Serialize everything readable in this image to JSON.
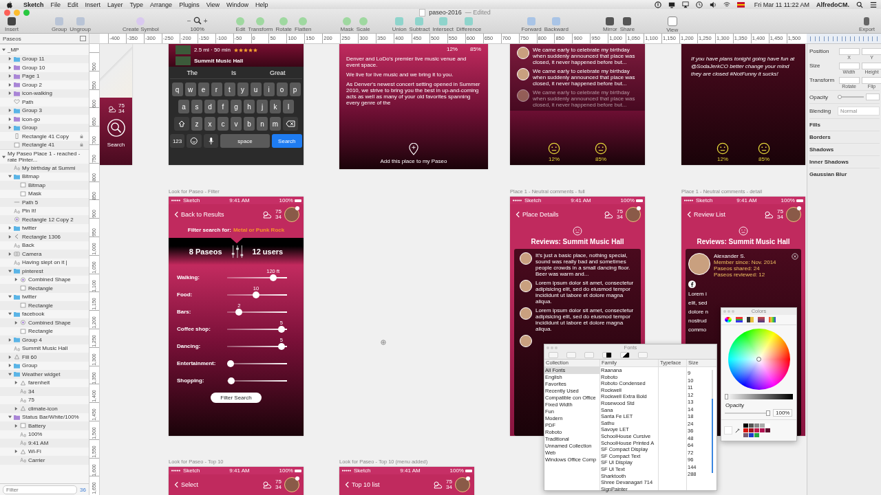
{
  "menubar": {
    "app": "Sketch",
    "menus": [
      "File",
      "Edit",
      "Insert",
      "Layer",
      "Type",
      "Arrange",
      "Plugins",
      "View",
      "Window",
      "Help"
    ],
    "clock": "Fri Mar 11  11:22 AM",
    "user": "AlfredoCM."
  },
  "window": {
    "title": "paseo-2016",
    "status": "— Edited"
  },
  "toolbar": {
    "groups": [
      {
        "kind": "tools",
        "items": [
          "Insert"
        ]
      },
      {
        "kind": "tools",
        "items": [
          "Group",
          "Ungroup"
        ]
      },
      {
        "kind": "tools",
        "items": [
          "Create Symbol"
        ]
      },
      {
        "kind": "zoom",
        "minus": "−",
        "plus": "+",
        "value": "100%"
      },
      {
        "kind": "tools",
        "items": [
          "Edit",
          "Transform",
          "Rotate",
          "Flatten"
        ]
      },
      {
        "kind": "tools",
        "items": [
          "Mask",
          "Scale"
        ]
      },
      {
        "kind": "tools",
        "items": [
          "Union",
          "Subtract",
          "Intersect",
          "Difference"
        ]
      },
      {
        "kind": "tools",
        "items": [
          "Forward",
          "Backward"
        ]
      },
      {
        "kind": "tools",
        "items": [
          "Mirror",
          "Share"
        ]
      },
      {
        "kind": "tools",
        "items": [
          "View"
        ]
      },
      {
        "kind": "tools",
        "items": [
          "Export"
        ]
      }
    ]
  },
  "rulers": {
    "horizontal": [
      "-400",
      "-350",
      "-300",
      "-250",
      "-200",
      "-150",
      "-100",
      "-50",
      "0",
      "50",
      "100",
      "150",
      "200",
      "250",
      "300",
      "350",
      "400",
      "450",
      "500",
      "550",
      "600",
      "650",
      "700",
      "750",
      "800",
      "850",
      "900",
      "950",
      "1,000",
      "1,050",
      "1,100",
      "1,150",
      "1,200",
      "1,250",
      "1,300",
      "1,350",
      "1,400",
      "1,450",
      "1,500"
    ],
    "vertical": [
      "500",
      "550",
      "600",
      "650",
      "700",
      "750",
      "800",
      "850",
      "900",
      "950",
      "1,000",
      "1,050",
      "1,100",
      "1,150",
      "1,200",
      "1,250",
      "1,300",
      "1,350",
      "1,400",
      "1,450",
      "1,500",
      "1,550",
      "1,600",
      "1,650"
    ]
  },
  "sidebar": {
    "page": "Paseos",
    "filter": {
      "placeholder": "Filter"
    },
    "count": "36",
    "layers": [
      {
        "name": "_MP",
        "kind": "artboard",
        "expanded": true,
        "children": [
          {
            "name": "Group 11",
            "kind": "group",
            "expanded": false,
            "locked": false
          },
          {
            "name": "Group 10",
            "kind": "symbol",
            "expanded": false,
            "locked": false
          },
          {
            "name": "Page 1",
            "kind": "symbol",
            "expanded": false,
            "locked": false
          },
          {
            "name": "Group 2",
            "kind": "symbol",
            "expanded": false,
            "locked": false
          },
          {
            "name": "icon-walking",
            "kind": "symbol",
            "expanded": false,
            "locked": false
          },
          {
            "name": "Path",
            "kind": "heart",
            "locked": false
          },
          {
            "name": "Group 3",
            "kind": "group",
            "expanded": false,
            "locked": false
          },
          {
            "name": "icon-go",
            "kind": "symbol",
            "expanded": false,
            "locked": false
          },
          {
            "name": "Group",
            "kind": "group",
            "expanded": false,
            "locked": false
          },
          {
            "name": "Rectangle 41 Copy",
            "kind": "phone",
            "locked": true
          },
          {
            "name": "Rectangle 41",
            "kind": "rect",
            "locked": true
          }
        ]
      },
      {
        "name": "My Paseo Place 1 - reached - rate Pinter...",
        "kind": "artboard",
        "expanded": true,
        "children": [
          {
            "name": "My birthday at Summi",
            "kind": "text"
          },
          {
            "name": "Bitmap",
            "kind": "group",
            "expanded": true,
            "children": [
              {
                "name": "Bitmap",
                "kind": "bitmap"
              },
              {
                "name": "Mask",
                "kind": "rect"
              }
            ]
          },
          {
            "name": "Path 5",
            "kind": "line"
          },
          {
            "name": "Pin It!",
            "kind": "text"
          },
          {
            "name": "Rectangle 12 Copy 2",
            "kind": "oval"
          },
          {
            "name": "twitter",
            "kind": "group",
            "expanded": false
          },
          {
            "name": "Rectangle 1306",
            "kind": "chevron",
            "expanded": false
          },
          {
            "name": "Back",
            "kind": "text"
          },
          {
            "name": "Camera",
            "kind": "camera",
            "expanded": false
          },
          {
            "name": "Having slept on it |",
            "kind": "text"
          },
          {
            "name": "pinterest",
            "kind": "group",
            "expanded": true,
            "children": [
              {
                "name": "Combined Shape",
                "kind": "oval",
                "expanded": false
              },
              {
                "name": "Rectangle",
                "kind": "rect"
              }
            ]
          },
          {
            "name": "twitter",
            "kind": "group",
            "expanded": true,
            "children": [
              {
                "name": "Rectangle",
                "kind": "rect"
              }
            ]
          },
          {
            "name": "facebook",
            "kind": "group",
            "expanded": true,
            "children": [
              {
                "name": "Combined Shape",
                "kind": "oval",
                "expanded": false
              },
              {
                "name": "Rectangle",
                "kind": "rect"
              }
            ]
          },
          {
            "name": "Group 4",
            "kind": "group",
            "expanded": false
          },
          {
            "name": "Summit Music Hall",
            "kind": "text"
          },
          {
            "name": "Fill 60",
            "kind": "shape",
            "expanded": false
          },
          {
            "name": "Group",
            "kind": "group",
            "expanded": false
          },
          {
            "name": "Weather widget",
            "kind": "group",
            "expanded": true,
            "children": [
              {
                "name": "farenheit",
                "kind": "shape",
                "expanded": false
              },
              {
                "name": "34",
                "kind": "text"
              },
              {
                "name": "75",
                "kind": "text"
              },
              {
                "name": "climate-icon",
                "kind": "shape",
                "expanded": false
              }
            ]
          },
          {
            "name": "Status Bar/White/100%",
            "kind": "symbol",
            "expanded": true,
            "children": [
              {
                "name": "Battery",
                "kind": "rect",
                "expanded": false
              },
              {
                "name": "100%",
                "kind": "text"
              },
              {
                "name": "9:41 AM",
                "kind": "text"
              },
              {
                "name": "Wi-Fi",
                "kind": "shape",
                "expanded": false
              },
              {
                "name": "Carrier",
                "kind": "text"
              }
            ]
          }
        ]
      }
    ]
  },
  "canvas": {
    "artboards": [
      {
        "kind": "map",
        "weather": {
          "high": "75",
          "low": "34"
        },
        "search": "Search"
      },
      {
        "kind": "keyboard",
        "distance": "2.5 mi · 50 min",
        "stars": 5,
        "venue": "Summit Music Hall",
        "suggestions": [
          "The",
          "Is",
          "Great"
        ],
        "rows": [
          [
            "q",
            "w",
            "e",
            "r",
            "t",
            "y",
            "u",
            "i",
            "o",
            "p"
          ],
          [
            "a",
            "s",
            "d",
            "f",
            "g",
            "h",
            "j",
            "k",
            "l"
          ],
          [
            "z",
            "x",
            "c",
            "v",
            "b",
            "n",
            "m"
          ]
        ],
        "numbers": "123",
        "space": "space",
        "action": "Search"
      },
      {
        "kind": "about",
        "stats": [
          "12%",
          "85%"
        ],
        "paragraphs": [
          "Denver and LoDo's premier live music venue and event space.",
          "We live for live music and we bring it to you.",
          "As Denver's newest concert setting opened in Summer 2010, we strive to bring you the best in up-and-coming acts as well as many of your old favorites spanning every genre of the"
        ],
        "cta": "Add this place to my Paseo"
      },
      {
        "kind": "comments",
        "comments": [
          "We came early to celebrate my birthday when suddenly announced that place was closed, it never happened before but...",
          "We came early to celebrate my birthday when suddenly announced that place was closed, it never happened before but...",
          "We came early to celebrate my birthday when suddenly announced that place was closed, it never happened before but..."
        ],
        "stats": [
          "12%",
          "85%"
        ]
      },
      {
        "kind": "tweet",
        "text": "If you have plans tonight going have fun at @SodaJerkCO better change your mind they are closed #NotFunny it sucks!",
        "stats": [
          "12%",
          "85%"
        ]
      },
      {
        "kind": "filter",
        "label": "Look for Paseo - Filter",
        "status": {
          "carrier": "Sketch",
          "time": "9:41 AM",
          "battery": "100%"
        },
        "back": "Back to Results",
        "weather": {
          "high": "75",
          "low": "34"
        },
        "filter_label": "Filter search for:",
        "filter_value": "Metal or Punk Rock",
        "paseos": "8 Paseos",
        "users": "12 users",
        "sliders": [
          {
            "name": "Walking:",
            "value": "120 ft",
            "level": 0.8
          },
          {
            "name": "Food:",
            "value": "10",
            "level": 0.48
          },
          {
            "name": "Bars:",
            "value": "2",
            "level": 0.16
          },
          {
            "name": "Coffee shop:",
            "value": "5",
            "level": 0.96
          },
          {
            "name": "Dancing:",
            "value": "5",
            "level": 0.96
          },
          {
            "name": "Entertainment:",
            "level": 0
          },
          {
            "name": "Shopping:",
            "level": 0.01
          }
        ],
        "button": "Filter Search"
      },
      {
        "kind": "reviews",
        "label": "Place 1 - Neutral comments - full",
        "status": {
          "carrier": "Sketch",
          "time": "9:41 AM",
          "battery": "100%"
        },
        "back": "Place Details",
        "weather": {
          "high": "75",
          "low": "34"
        },
        "title": "Reviews: Summit Music Hall",
        "reviews": [
          "It's just a basic place, nothing special, sound was really bad and sometimes people crowds in a small dancing floor. Beer was warm and...",
          "Lorem ipsum dolor sit amet, consectetur adipisicing elit, sed do eiusmod tempor incididunt ut labore et dolore magna aliqua.",
          "Lorem ipsum dolor sit amet, consectetur adipisicing elit, sed do eiusmod tempor incididunt ut labore et dolore magna aliqua."
        ]
      },
      {
        "kind": "detail",
        "label": "Place 1 - Neutral comments - detail",
        "status": {
          "carrier": "Sketch",
          "time": "9:41 AM",
          "battery": "100%"
        },
        "back": "Review List",
        "weather": {
          "high": "75",
          "low": "34"
        },
        "title": "Reviews: Summit Music Hall",
        "name": "Alexander S.",
        "meta": [
          "Member since: Nov. 2014",
          "Paseos shared: 24",
          "Paseos reviewed: 12"
        ],
        "fragments": [
          "Lorem i",
          "elit, sed",
          "dolore n",
          "nostrud",
          "commo"
        ]
      },
      {
        "kind": "list",
        "label": "Look for Paseo - Top 10",
        "status": {
          "carrier": "Sketch",
          "time": "9:41 AM",
          "battery": "100%"
        },
        "back": "Select",
        "weather": {
          "high": "75",
          "low": "34"
        }
      },
      {
        "kind": "list",
        "label": "Look for Paseo - Top 10 (menu added)",
        "status": {
          "carrier": "Sketch",
          "time": "9:41 AM",
          "battery": "100%"
        },
        "back": "Top 10 list",
        "weather": {
          "high": "75",
          "low": "34"
        }
      }
    ]
  },
  "fonts_panel": {
    "title": "Fonts",
    "columns": [
      "Collection",
      "Family",
      "Typeface",
      "Size"
    ],
    "collections": [
      {
        "name": "All Fonts",
        "selected": true
      },
      {
        "name": "English",
        "selected": false
      },
      {
        "name": "Favorites",
        "selected": false
      },
      {
        "name": "Recently Used",
        "selected": false
      },
      {
        "name": "Compatible con Office",
        "selected": false
      },
      {
        "name": "Fixed Width",
        "selected": false
      },
      {
        "name": "Fun",
        "selected": false
      },
      {
        "name": "Modern",
        "selected": false
      },
      {
        "name": "PDF",
        "selected": false
      },
      {
        "name": "Roboto",
        "selected": false
      },
      {
        "name": "Traditional",
        "selected": false
      },
      {
        "name": "Unnamed Collection",
        "selected": false
      },
      {
        "name": "Web",
        "selected": false
      },
      {
        "name": "Windows Office Comp",
        "selected": false
      }
    ],
    "families": [
      "Raanana",
      "Roboto",
      "Roboto Condensed",
      "Rockwell",
      "Rockwell Extra Bold",
      "Rosewood Std",
      "Sana",
      "Santa Fe LET",
      "Sathu",
      "Savoye LET",
      "SchoolHouse Cursive",
      "SchoolHouse Printed A",
      "SF Compact Display",
      "SF Compact Text",
      "SF UI Display",
      "SF UI Text",
      "Sharktooth",
      "Shree Devanagari 714",
      "SignPainter"
    ],
    "sizes": [
      "9",
      "10",
      "11",
      "12",
      "13",
      "14",
      "18",
      "24",
      "36",
      "48",
      "64",
      "72",
      "96",
      "144",
      "288"
    ],
    "size_slider": {
      "level": 0.72
    }
  },
  "colors_panel": {
    "title": "Colors",
    "brightness": {
      "level": 0
    },
    "opacity_label": "Opacity",
    "opacity": {
      "level": 1
    },
    "opacity_value": "100%",
    "swatches": [
      {
        "color": "#000000"
      },
      {
        "color": "#555555"
      },
      {
        "color": "#888888"
      },
      {
        "color": "#aaaaaa"
      },
      {
        "color": "#ffffff"
      },
      {
        "color": "#d8140f"
      },
      {
        "color": "#a0121e"
      },
      {
        "color": "#c0194a"
      },
      {
        "color": "#b0104f"
      },
      {
        "color": "#5a0e2c"
      },
      {
        "color": "#7a5a70"
      },
      {
        "color": "#1c3fc8"
      },
      {
        "color": "#27a844"
      }
    ]
  },
  "inspector": {
    "fields": [
      {
        "label": "Position",
        "sub": [
          "X",
          "Y"
        ]
      },
      {
        "label": "Size",
        "sub": [
          "Width",
          "Height"
        ]
      },
      {
        "label": "Transform",
        "sub": [
          "Rotate",
          "Flip"
        ]
      }
    ],
    "opacity": "Opacity",
    "opacity_slider": {
      "level": 0
    },
    "blending": "Blending",
    "blend_value": "Normal",
    "sections": [
      "Fills",
      "Borders",
      "Shadows",
      "Inner Shadows",
      "Gaussian Blur"
    ]
  }
}
